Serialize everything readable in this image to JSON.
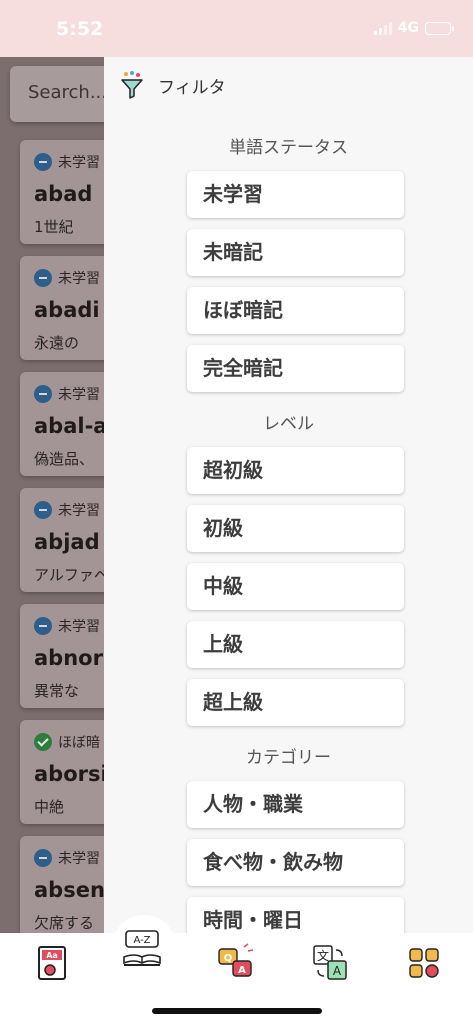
{
  "status_bar": {
    "time": "5:52",
    "network": "4G"
  },
  "search": {
    "placeholder": "Search..."
  },
  "word_list": [
    {
      "status": "未学習",
      "word": "abad",
      "meaning": "1世紀",
      "done": false
    },
    {
      "status": "未学習",
      "word": "abadi",
      "meaning": "永遠の",
      "done": false
    },
    {
      "status": "未学習",
      "word": "abal-a",
      "meaning": "偽造品、",
      "done": false
    },
    {
      "status": "未学習",
      "word": "abjad",
      "meaning": "アルファベ",
      "done": false
    },
    {
      "status": "未学習",
      "word": "abnorr",
      "meaning": "異常な",
      "done": false
    },
    {
      "status": "ほぼ暗",
      "word": "aborsi",
      "meaning": "中絶",
      "done": true
    },
    {
      "status": "未学習",
      "word": "absen",
      "meaning": "欠席する",
      "done": false
    }
  ],
  "drawer": {
    "title": "フィルタ",
    "sections": [
      {
        "title": "単語ステータス",
        "options": [
          "未学習",
          "未暗記",
          "ほぼ暗記",
          "完全暗記"
        ]
      },
      {
        "title": "レベル",
        "options": [
          "超初級",
          "初級",
          "中級",
          "上級",
          "超上級"
        ]
      },
      {
        "title": "カテゴリー",
        "options": [
          "人物・職業",
          "食べ物・飲み物",
          "時間・曜日"
        ]
      }
    ]
  },
  "tabbar": {
    "tabs": [
      {
        "icon": "flashcard-icon",
        "label": "Aa"
      },
      {
        "icon": "dictionary-icon",
        "label": "A-Z"
      },
      {
        "icon": "quiz-icon",
        "label": "Q A"
      },
      {
        "icon": "translate-icon",
        "label": "文 A"
      },
      {
        "icon": "menu-grid-icon",
        "label": ""
      }
    ]
  },
  "colors": {
    "accent": "#e04e5e",
    "drawer_bg": "#f7f7f7",
    "overlay": "#7c6e6f"
  }
}
